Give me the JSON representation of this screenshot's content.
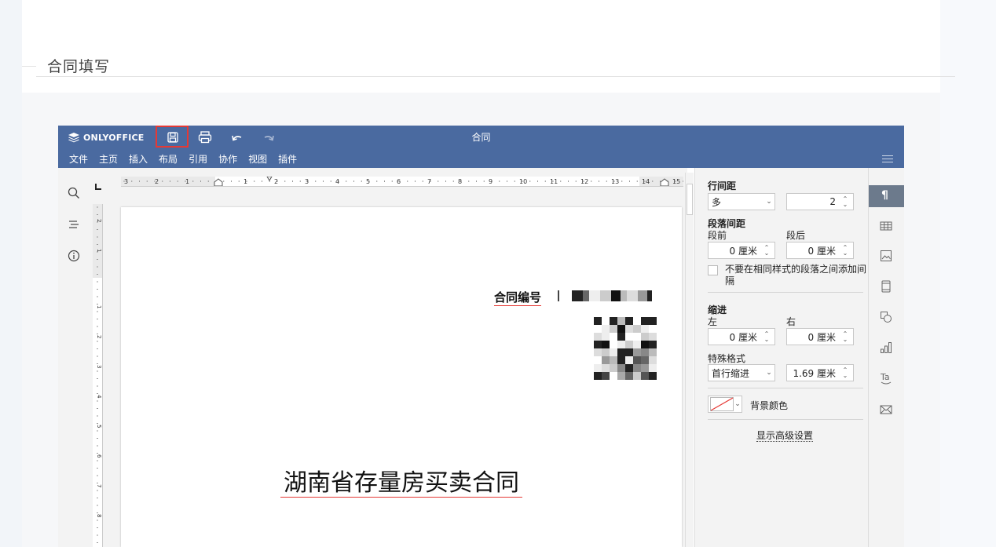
{
  "page": {
    "title": "合同填写"
  },
  "editor": {
    "brand": "ONLYOFFICE",
    "document_title": "合同",
    "menu": [
      "文件",
      "主页",
      "插入",
      "布局",
      "引用",
      "协作",
      "视图",
      "插件"
    ],
    "toolbar_icons": [
      "save-icon",
      "print-icon",
      "undo-icon",
      "redo-icon"
    ],
    "ruler_numbers": [
      "3",
      "2",
      "1",
      "1",
      "2",
      "3",
      "4",
      "5",
      "6",
      "7",
      "8",
      "9",
      "10",
      "11",
      "12",
      "13",
      "14",
      "15"
    ],
    "vruler_numbers": [
      "2",
      "1",
      "1",
      "2",
      "3",
      "4",
      "5",
      "6",
      "7",
      "8"
    ]
  },
  "document": {
    "contract_no_label": "合同编号",
    "heading": "湖南省存量房买卖合同"
  },
  "panel": {
    "line_spacing": {
      "label": "行间距",
      "mode": "多",
      "value": "2"
    },
    "paragraph_spacing": {
      "label": "段落间距",
      "before_label": "段前",
      "after_label": "段后",
      "before": "0 厘米",
      "after": "0 厘米"
    },
    "no_space_checkbox": "不要在相同样式的段落之间添加间隔",
    "indent": {
      "label": "缩进",
      "left_label": "左",
      "right_label": "右",
      "left": "0 厘米",
      "right": "0 厘米"
    },
    "special": {
      "label": "特殊格式",
      "mode": "首行缩进",
      "value": "1.69 厘米"
    },
    "background_label": "背景颜色",
    "advanced_link": "显示高级设置"
  },
  "colors": {
    "header": "#4a6aa0",
    "highlight": "#e53935"
  }
}
